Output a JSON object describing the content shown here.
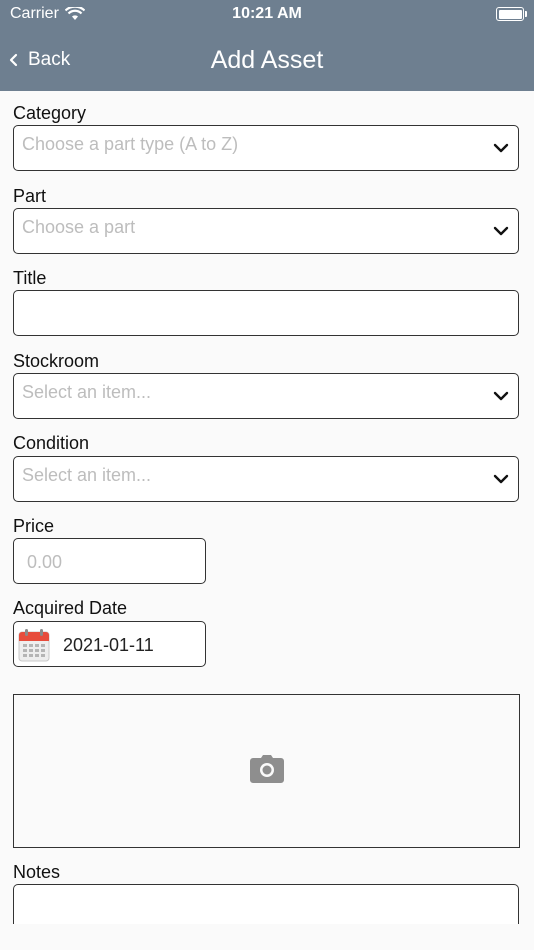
{
  "status_bar": {
    "carrier": "Carrier",
    "time": "10:21 AM"
  },
  "nav": {
    "back_label": "Back",
    "title": "Add Asset"
  },
  "form": {
    "category": {
      "label": "Category",
      "placeholder": "Choose a part type (A to Z)"
    },
    "part": {
      "label": "Part",
      "placeholder": "Choose a part"
    },
    "title": {
      "label": "Title",
      "value": ""
    },
    "stockroom": {
      "label": "Stockroom",
      "placeholder": "Select an item..."
    },
    "condition": {
      "label": "Condition",
      "placeholder": "Select an item..."
    },
    "price": {
      "label": "Price",
      "placeholder": "0.00"
    },
    "acquired_date": {
      "label": "Acquired Date",
      "value": "2021-01-11"
    },
    "notes": {
      "label": "Notes"
    }
  },
  "icons": {
    "wifi": "wifi-icon",
    "battery": "battery-icon",
    "back": "chevron-left-icon",
    "dropdown": "chevron-down-icon",
    "calendar": "calendar-icon",
    "camera": "camera-icon"
  },
  "colors": {
    "nav_bar": "#6e7f90",
    "calendar_red": "#e74c3c"
  }
}
